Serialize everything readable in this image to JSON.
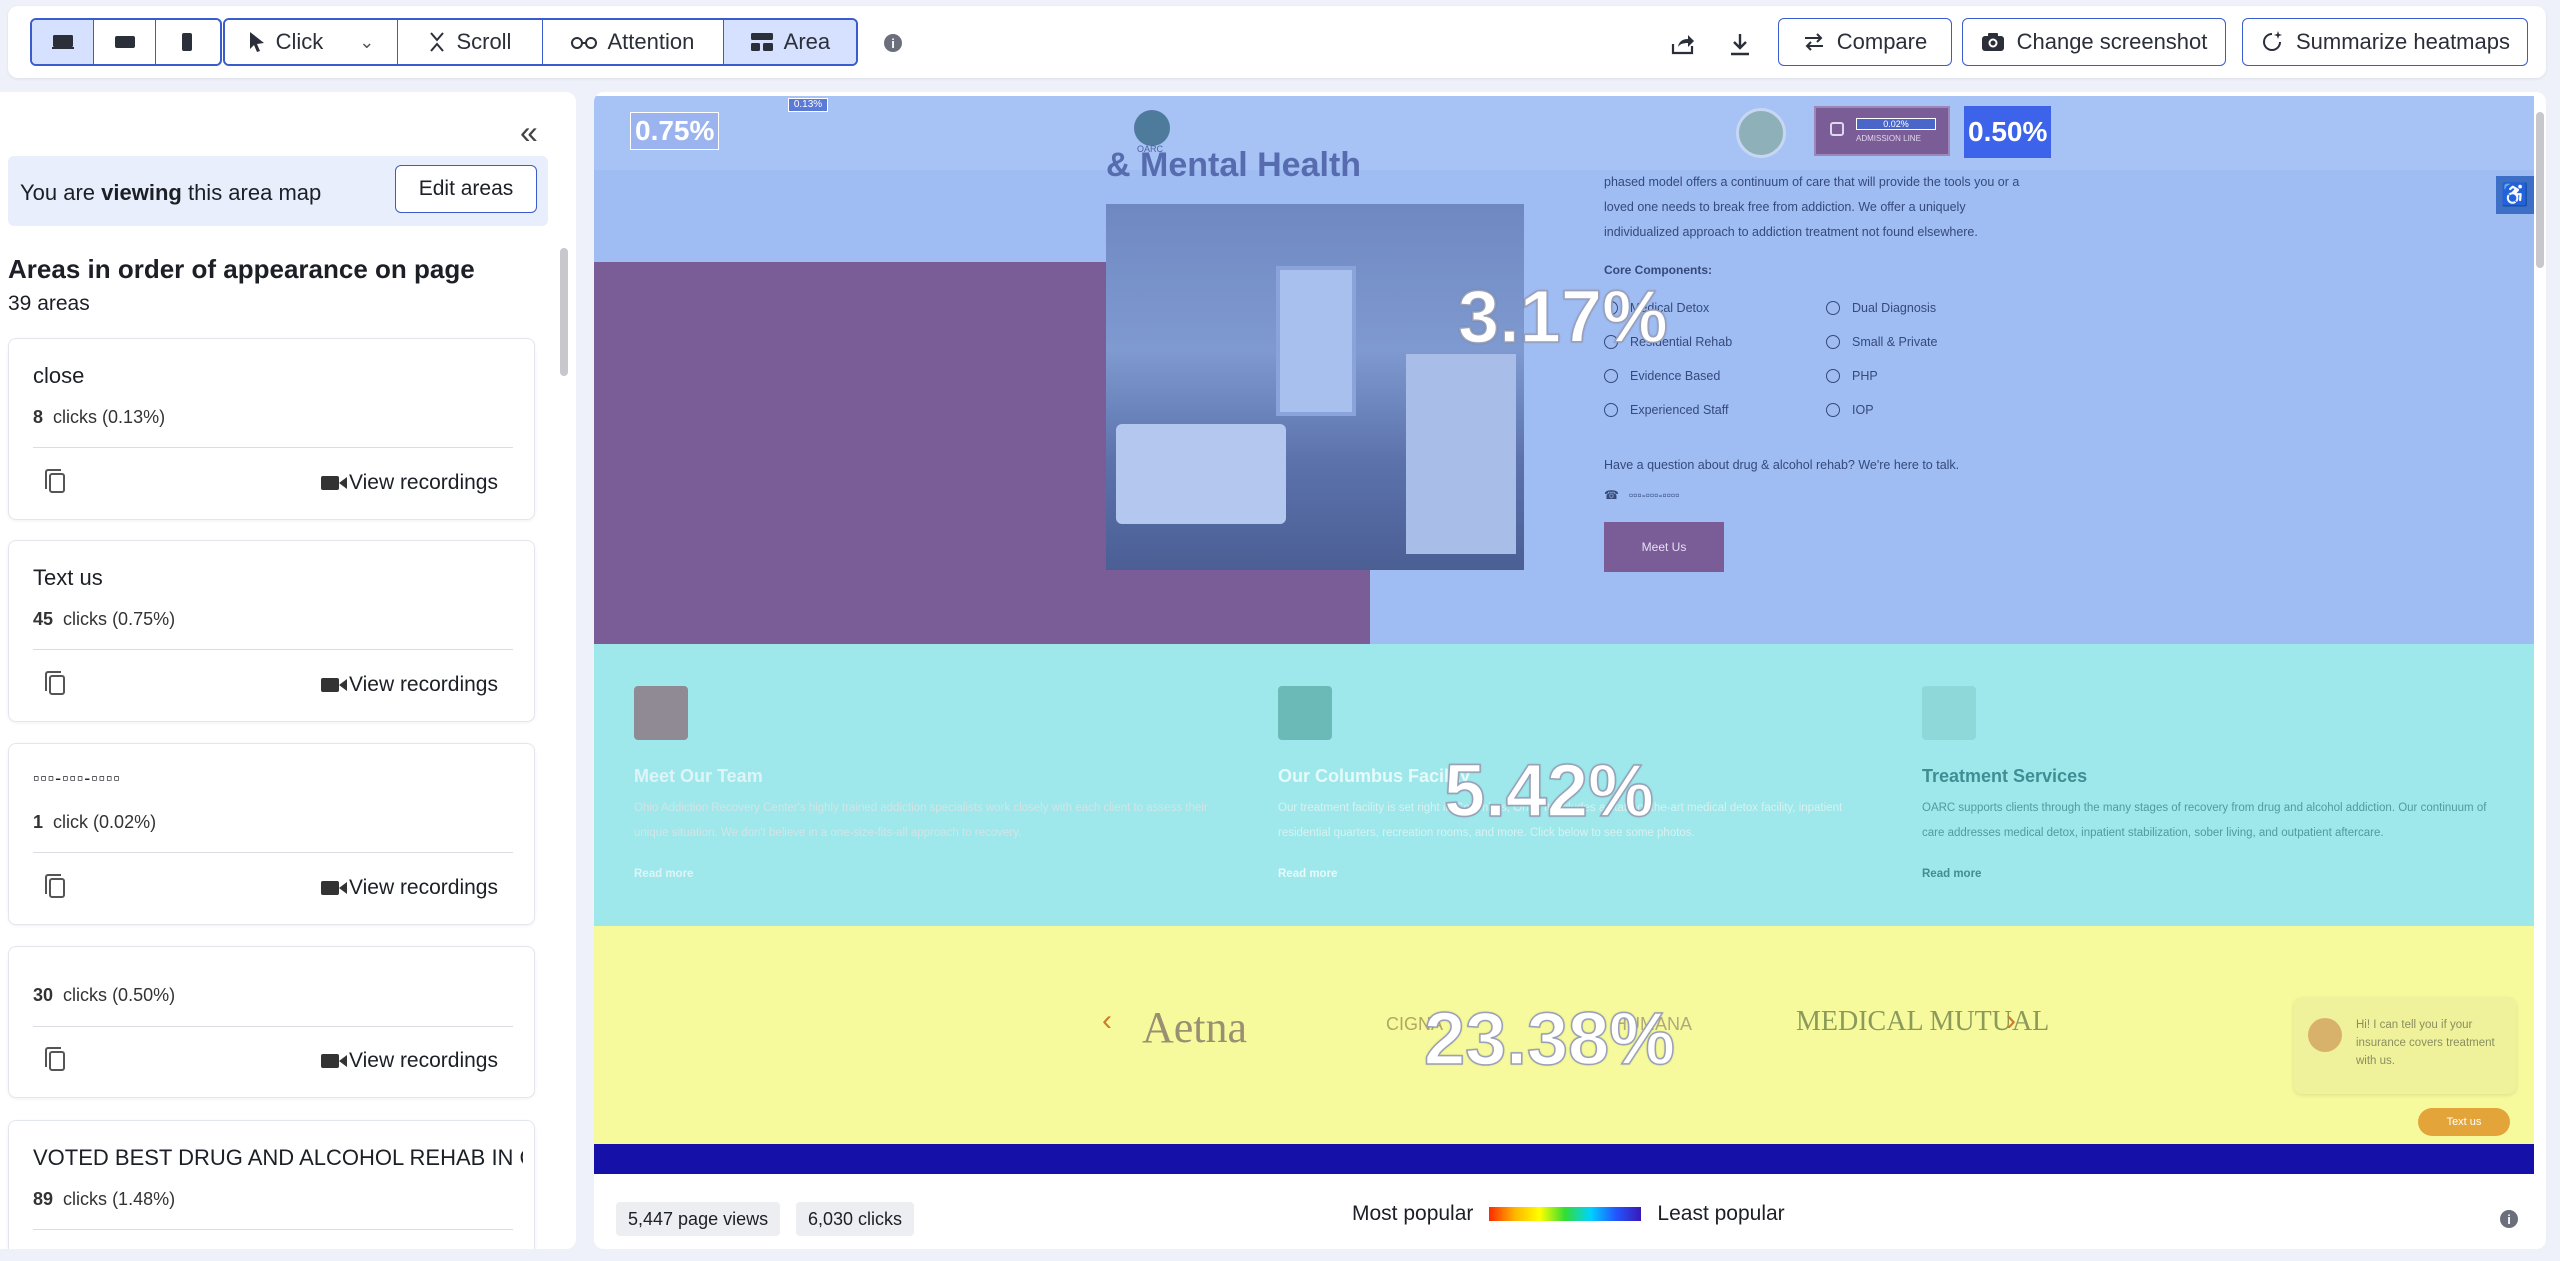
{
  "toolbar": {
    "devices": [
      {
        "name": "desktop-icon",
        "active": true
      },
      {
        "name": "tablet-icon",
        "active": false
      },
      {
        "name": "mobile-icon",
        "active": false
      }
    ],
    "modes": {
      "click": "Click",
      "scroll": "Scroll",
      "attention": "Attention",
      "area": "Area"
    },
    "active_mode": "Area",
    "info": "i",
    "compare": "Compare",
    "change_screenshot": "Change screenshot",
    "summarize": "Summarize heatmaps"
  },
  "sidebar": {
    "viewing_prefix": "You are ",
    "viewing_bold": "viewing",
    "viewing_suffix": " this area map",
    "edit_areas": "Edit areas",
    "title": "Areas in order of appearance on page",
    "count": "39 areas",
    "view_recordings": "View recordings",
    "areas": [
      {
        "name": "close",
        "count": "8",
        "unit": "clicks",
        "pct": "(0.13%)"
      },
      {
        "name": "Text us",
        "count": "45",
        "unit": "clicks",
        "pct": "(0.75%)"
      },
      {
        "name": "▫▫▫-▫▫▫-▫▫▫▫",
        "count": "1",
        "unit": "click",
        "pct": "(0.02%)"
      },
      {
        "name": "",
        "count": "30",
        "unit": "clicks",
        "pct": "(0.50%)"
      },
      {
        "name": "VOTED BEST DRUG AND ALCOHOL REHAB IN COLU",
        "count": "89",
        "unit": "clicks",
        "pct": "(1.48%)"
      }
    ]
  },
  "preview": {
    "header_pcts": {
      "left": "0.75%",
      "tiny": "0.13%",
      "right": "0.50%",
      "phone_bubble": "0.02%"
    },
    "hero": {
      "title": "& Mental Health",
      "paragraph": [
        "phased model offers a continuum of care that will provide the tools you or a",
        "loved one needs to break free from addiction. We offer a uniquely",
        "individualized approach to addiction treatment not found elsewhere."
      ],
      "core_title": "Core Components:",
      "components_left": [
        "Medical Detox",
        "Residential Rehab",
        "Evidence Based",
        "Experienced Staff"
      ],
      "components_right": [
        "Dual Diagnosis",
        "Small & Private",
        "PHP",
        "IOP"
      ],
      "question": "Have a question about drug & alcohol rehab? We're here to talk.",
      "phone": "▫▫▫-▫▫▫-▫▫▫▫",
      "meet_us": "Meet Us",
      "pct": "3.17%"
    },
    "features": [
      {
        "title": "Meet Our Team",
        "desc": "Ohio Addiction Recovery Center's highly trained addiction specialists work closely with each client to assess their unique situation. We don't believe in a one-size-fits-all approach to recovery.",
        "link": "Read more",
        "bg": "#7b8f93"
      },
      {
        "title": "Our Columbus Facility",
        "desc": "Our treatment facility is set right in Columbus, Ohio. It includes a state-of-the-art medical detox facility, inpatient residential quarters, recreation rooms, and more. Click below to see some photos.",
        "link": "Read more",
        "bg": "#4fa9a8"
      },
      {
        "title": "Treatment Services",
        "desc": "OARC supports clients through the many stages of recovery from drug and alcohol addiction. Our continuum of care addresses medical detox, inpatient stabilization, sober living, and outpatient aftercare.",
        "link": "Read more",
        "bg": "#a3e9ec"
      }
    ],
    "features_pct": "5.42%",
    "logos": [
      "Aetna",
      "CIGNA",
      "HUMANA",
      "MEDICAL MUTUAL"
    ],
    "logos_pct": "23.38%",
    "chat_bubble": "Hi! I can tell you if your insurance covers treatment with us.",
    "text_us": "Text us",
    "logo_label": "OARC",
    "admission_line": "ADMISSION LINE"
  },
  "footer": {
    "page_views": "5,447 page views",
    "clicks": "6,030 clicks",
    "most_popular": "Most popular",
    "least_popular": "Least popular",
    "info": "i"
  },
  "colors": {
    "accent": "#3b5ccc",
    "active_tab": "#d6e0ff",
    "zone_header": "#a7c2f5",
    "zone_hero": "#9fbcf3",
    "zone_cards": "#9ee8ec",
    "zone_logos": "#f6fa9d",
    "zone_footer": "#1511a8"
  }
}
